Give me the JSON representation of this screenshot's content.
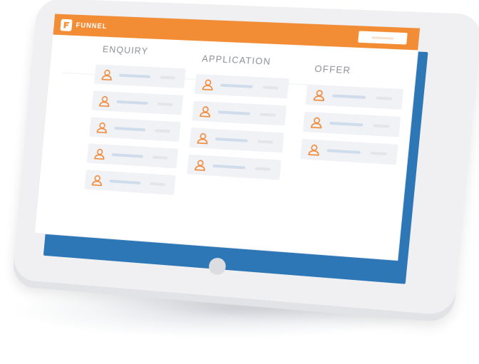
{
  "app": {
    "title": "FUNNEL",
    "logo_letter": "F"
  },
  "colors": {
    "header": "#f38d35",
    "accent_back": "#2e77b7",
    "card": "#f1f2f6",
    "avatar_icon": "#f08a3a"
  },
  "columns": [
    {
      "title": "ENQUIRY",
      "card_count": 5
    },
    {
      "title": "APPLICATION",
      "card_count": 4
    },
    {
      "title": "OFFER",
      "card_count": 3
    }
  ],
  "icons": {
    "logo": "f-logo-icon",
    "avatar": "person-icon",
    "home": "home-button"
  }
}
